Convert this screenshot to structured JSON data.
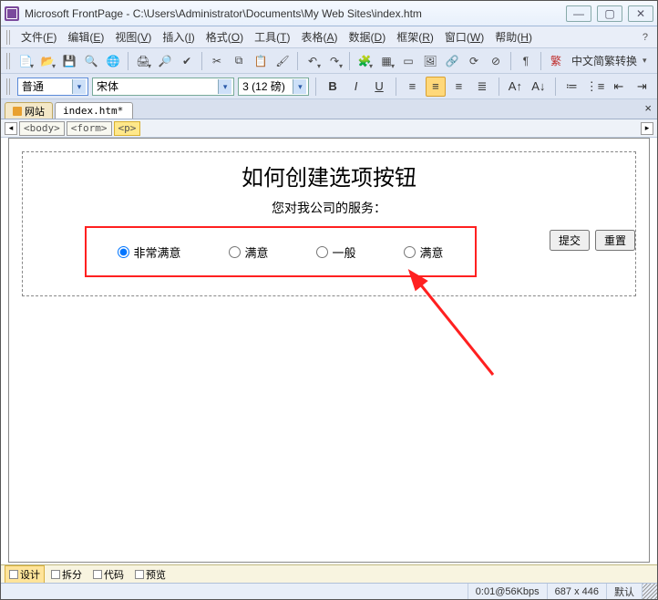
{
  "titlebar": {
    "app": "Microsoft FrontPage",
    "path": "C:\\Users\\Administrator\\Documents\\My Web Sites\\index.htm"
  },
  "menu": {
    "items": [
      {
        "label": "文件",
        "key": "F"
      },
      {
        "label": "编辑",
        "key": "E"
      },
      {
        "label": "视图",
        "key": "V"
      },
      {
        "label": "插入",
        "key": "I"
      },
      {
        "label": "格式",
        "key": "O"
      },
      {
        "label": "工具",
        "key": "T"
      },
      {
        "label": "表格",
        "key": "A"
      },
      {
        "label": "数据",
        "key": "D"
      },
      {
        "label": "框架",
        "key": "R"
      },
      {
        "label": "窗口",
        "key": "W"
      },
      {
        "label": "帮助",
        "key": "H"
      }
    ]
  },
  "toolbar2": {
    "convert_label": "中文简繁转换"
  },
  "format": {
    "style": "普通",
    "font": "宋体",
    "size": "3 (12 磅)"
  },
  "tabs": {
    "tab1": "网站",
    "tab2": "index.htm*"
  },
  "breadcrumb": [
    "<body>",
    "<form>",
    "<p>"
  ],
  "page": {
    "heading": "如何创建选项按钮",
    "subtitle": "您对我公司的服务：",
    "options": [
      "非常满意",
      "满意",
      "一般",
      "满意"
    ],
    "submit": "提交",
    "reset": "重置"
  },
  "views": {
    "design": "设计",
    "split": "拆分",
    "code": "代码",
    "preview": "预览"
  },
  "status": {
    "speed": "0:01@56Kbps",
    "dims": "687 x 446",
    "mode": "默认"
  }
}
